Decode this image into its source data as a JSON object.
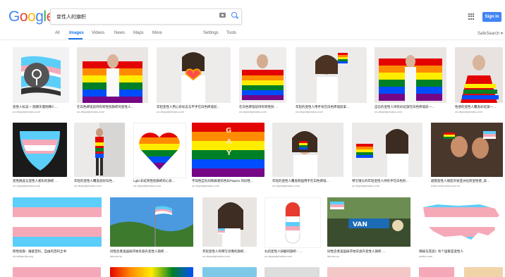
{
  "logo": {
    "text": "Google",
    "letters": [
      "G",
      "o",
      "o",
      "g",
      "l",
      "e"
    ],
    "colors": [
      "#4285f4",
      "#ea4335",
      "#fbbc05",
      "#4285f4",
      "#34a853",
      "#ea4335"
    ]
  },
  "search": {
    "query": "变性人的旗帜"
  },
  "header": {
    "signin_label": "Sign in"
  },
  "tabs": [
    {
      "label": "All"
    },
    {
      "label": "Images"
    },
    {
      "label": "Videos"
    },
    {
      "label": "News"
    },
    {
      "label": "Maps"
    },
    {
      "label": "More"
    }
  ],
  "tools": {
    "settings": "Settings",
    "tools": "Tools",
    "safesearch": "SafeSearch ▾"
  },
  "results": [
    {
      "caption": "变性人标志— 图库矢量图像© ...",
      "source": "cn.depositphotos.com"
    },
    {
      "caption": "在白色砖墙前持有跨性别旗帜的变性人…",
      "source": "cn.depositphotos.com"
    },
    {
      "caption": "年轻变性人用心形标志与平手在白色砖墙前…",
      "source": "cn.depositphotos.com"
    },
    {
      "caption": "在白色砖墙前持有跨性别 …",
      "source": "cn.depositphotos.com"
    },
    {
      "caption": "年轻的变性人用手背在白色砖墙前拿…",
      "source": "cn.depositphotos.com"
    },
    {
      "caption": "自信的变性人持有彩虹旗在白色砖墙前—…",
      "source": "cn.depositphotos.com"
    },
    {
      "caption": "性感的变性人覆盖彩虹旗—…",
      "source": "cn.depositphotos.com"
    },
    {
      "caption": "变性跳选与变性人者彩的旗帜 …",
      "source": "cn.depositphotos.com"
    },
    {
      "caption": "年轻的变性人覆盖良好白色…",
      "source": "cn.depositphotos.com"
    },
    {
      "caption": "Lgbt 彩虹跨性别旗帜的心形…",
      "source": "cn.depositphotos.com"
    },
    {
      "caption": "字母性自负同和鲜艳的色彩Papers 的同性…",
      "source": "cn.depositphotos.com"
    },
    {
      "caption": "年轻的变性人覆盖跨国用手在白色砖墙…",
      "source": "cn.depositphotos.com"
    },
    {
      "caption": "特写镜头的年轻变性人持有手在白色的…",
      "source": "cn.depositphotos.com"
    },
    {
      "caption": "越南变性人朋友庆祝亚洲化跨变性者_高…",
      "source": "dolls.news.sina.com.cn"
    },
    {
      "caption": "跨性别旗 - 维基百科，自由的百科全书",
      "source": "zh.wikipedia.org"
    },
    {
      "caption": "同性恋者美国肩开始毕竟升变性人旗帜 …",
      "source": "lahora.ua"
    },
    {
      "caption": "年轻变性人的特写肖像的旗帜…",
      "source": "cn.depositphotos.com"
    },
    {
      "caption": "丸的变性人研磨的旗帜 - …",
      "source": "cn.depositphotos.com"
    },
    {
      "caption": "同性恋者美国肩开始毕竟升变性人旗帜 …",
      "source": "lahora.ua"
    },
    {
      "caption": "揭秘马克思》有个国家是变性人",
      "source": "weibo.com"
    }
  ],
  "colors": {
    "trans_blue": "#5bcefa",
    "trans_pink": "#f5a9b8",
    "white": "#ffffff"
  }
}
